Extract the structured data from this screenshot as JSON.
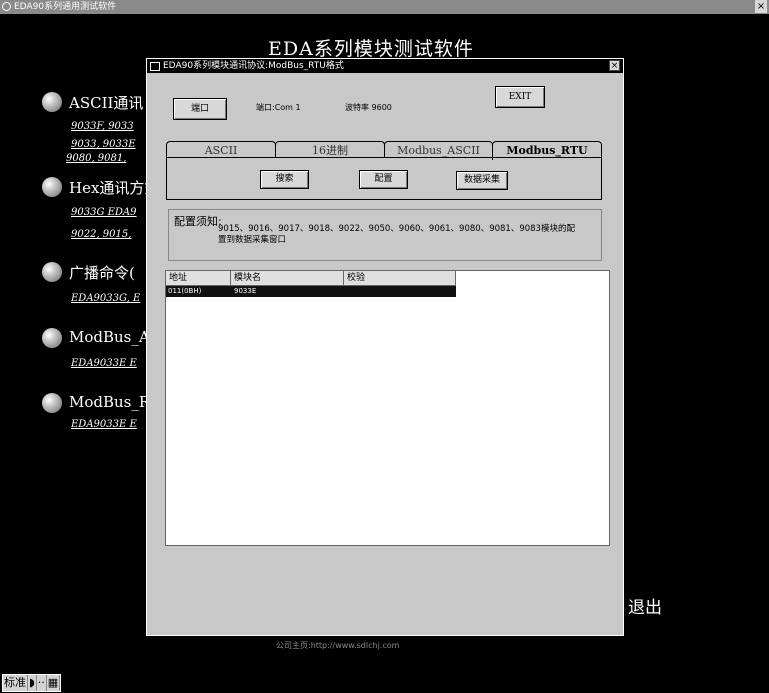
{
  "app": {
    "title": "EDA90系列通用测试软件",
    "close": "×",
    "banner": "EDA系列模块测试软件",
    "exit_label": "退出",
    "footer": "公司主页:http://www.sdlchj.com"
  },
  "menu": [
    {
      "label": "ASCII通讯",
      "links": [
        "9033F, 9033",
        "9033, 9033E",
        "9080, 9081,"
      ]
    },
    {
      "label": "Hex通讯方式",
      "links": [
        "9033G  EDA9",
        "9022, 9015,"
      ]
    },
    {
      "label": "广播命令(",
      "links": [
        "EDA9033G, E"
      ]
    },
    {
      "label": "ModBus_ASC",
      "links": [
        "EDA9033E  E"
      ]
    },
    {
      "label": "ModBus_RTU",
      "links": [
        "EDA9033E  E"
      ]
    }
  ],
  "ime": [
    "标准",
    "◗",
    "··",
    "▦"
  ],
  "dialog": {
    "title": "EDA90系列模块通讯协议:ModBus_RTU格式",
    "close": "×",
    "port_button": "端口",
    "port_text": "端口:Com 1",
    "baud_text": "波特率 9600",
    "exit_button": "EXIT",
    "tabs": [
      "ASCII",
      "16进制",
      "Modbus_ASCII",
      "Modbus_RTU"
    ],
    "actions": {
      "search": "搜索",
      "config": "配置",
      "collect": "数据采集"
    },
    "notice_head": "配置须知:",
    "notice_body": "9015、9016、9017、9018、9022、9050、9060、9061、9080、9081、9083模块的配置到数据采集窗口",
    "columns": [
      "地址",
      "模块名",
      "校验"
    ],
    "rows": [
      {
        "addr": "011(0BH)",
        "name": "9033E",
        "check": ""
      }
    ]
  }
}
